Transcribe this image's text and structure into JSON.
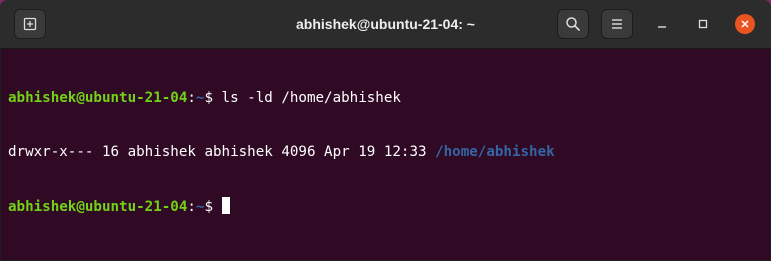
{
  "window": {
    "title": "abhishek@ubuntu-21-04: ~"
  },
  "titlebar": {
    "new_tab_icon": "new-tab-icon",
    "search_icon": "search-icon",
    "menu_icon": "hamburger-menu-icon",
    "minimize_icon": "minimize-icon",
    "maximize_icon": "maximize-icon",
    "close_icon": "close-icon"
  },
  "terminal": {
    "lines": [
      {
        "user_host": "abhishek@ubuntu-21-04",
        "colon": ":",
        "cwd": "~",
        "dollar": "$",
        "command": " ls -ld /home/abhishek"
      },
      {
        "output": "drwxr-x--- 16 abhishek abhishek 4096 Apr 19 12:33 ",
        "output_path": "/home/abhishek"
      },
      {
        "user_host": "abhishek@ubuntu-21-04",
        "colon": ":",
        "cwd": "~",
        "dollar": "$",
        "command": " "
      }
    ]
  },
  "colors": {
    "terminal_background": "#300a24",
    "titlebar_background": "#2c2c2c",
    "prompt_user": "#73d216",
    "prompt_path": "#3465a4",
    "directory_output": "#3465a4",
    "text": "#ffffff",
    "close_button": "#e95420"
  }
}
